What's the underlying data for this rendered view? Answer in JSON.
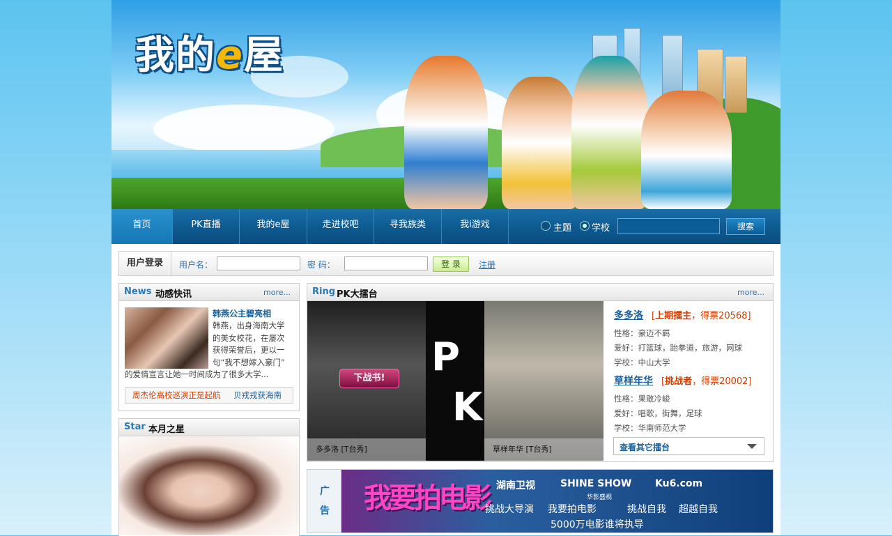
{
  "site": {
    "logo_text": "我的e屋",
    "logo_prefix": "我的",
    "logo_e": "e",
    "logo_suffix": "屋"
  },
  "nav": {
    "items": [
      "首页",
      "PK直播",
      "我的e屋",
      "走进校吧",
      "寻我族类",
      "我i游戏"
    ],
    "search_options": [
      "主题",
      "学校"
    ],
    "selected_option": "学校",
    "search_value": "",
    "search_button": "搜索"
  },
  "login": {
    "title": "用户登录",
    "username_label": "用户名：",
    "password_label": "密  码：",
    "login_button": "登 录",
    "register_link": "注册"
  },
  "news": {
    "en": "News",
    "cn": "动感快讯",
    "more": "more...",
    "headline": "韩燕公主碧亮相",
    "body_line1": "韩燕，出身海南大学",
    "body_line2": "的美女校花，在屡次",
    "body_line3": "获得荣誉后，更以一",
    "body_line4": "句“我不想嫁入豪门”",
    "body_line5": "的爱情宣言让她一时间成为了很多大学...",
    "ticker_left": "周杰伦高校巡演正是起航",
    "ticker_right": "贝戎戎获海南"
  },
  "star": {
    "en": "Star",
    "cn": "本月之星"
  },
  "pk": {
    "en": "Ring",
    "cn": "PK大擂台",
    "more": "more...",
    "challenge_button": "下战书!",
    "letter_p": "P",
    "letter_k": "K",
    "left_caption": "多多洛 [T台秀]",
    "right_caption": "草样年华 [T台秀]",
    "champion": {
      "name": "多多洛",
      "tag_prefix": "[",
      "tag_role": "上期擂主",
      "tag_votes": "，得票20568]",
      "personality": "性格：豪迈不羁",
      "hobby": "爱好：打篮球，跆拳道，旅游，网球",
      "school": "学校：中山大学"
    },
    "challenger": {
      "name": "草样年华",
      "tag_prefix": "[",
      "tag_role": "挑战者",
      "tag_votes": "，得票20002]",
      "personality": "性格：果敢冷峻",
      "hobby": "爱好：唱歌，街舞，足球",
      "school": "学校：华南师范大学"
    },
    "view_more": "查看其它擂台"
  },
  "ad": {
    "label_1": "广",
    "label_2": "告",
    "big_text": "我要拍电影",
    "brand_1": "湖南卫视",
    "brand_2": "SHINE SHOW",
    "brand_2_sub": "华影盛视",
    "brand_3": "Ku6.com",
    "line_1": "挑战大导演",
    "line_2": "我要拍电影",
    "line_3": "挑战自我",
    "line_4": "超越自我",
    "line_5": "5000万电影谁将执导"
  }
}
